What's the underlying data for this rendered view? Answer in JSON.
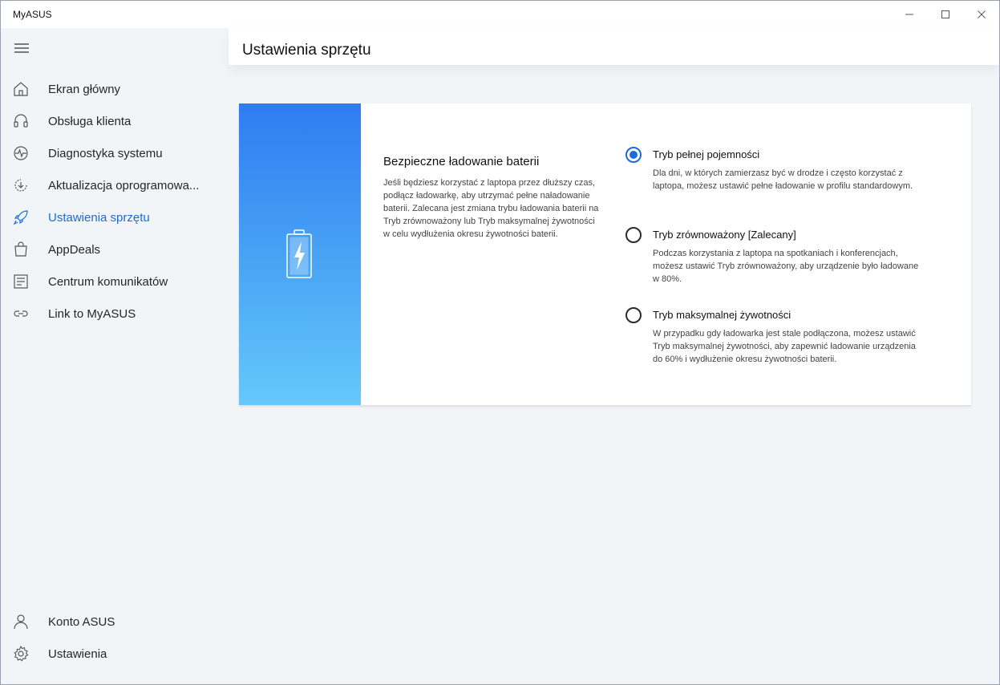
{
  "window": {
    "title": "MyASUS"
  },
  "sidebar": {
    "items": [
      {
        "label": "Ekran główny",
        "icon": "home-icon"
      },
      {
        "label": "Obsługa klienta",
        "icon": "headset-icon"
      },
      {
        "label": "Diagnostyka systemu",
        "icon": "pulse-icon"
      },
      {
        "label": "Aktualizacja oprogramowa...",
        "icon": "update-icon"
      },
      {
        "label": "Ustawienia sprzętu",
        "icon": "rocket-icon",
        "active": true
      },
      {
        "label": "AppDeals",
        "icon": "bag-icon"
      },
      {
        "label": "Centrum komunikatów",
        "icon": "news-icon"
      },
      {
        "label": "Link to MyASUS",
        "icon": "link-icon"
      }
    ],
    "bottom_items": [
      {
        "label": "Konto ASUS",
        "icon": "user-icon"
      },
      {
        "label": "Ustawienia",
        "icon": "gear-icon"
      }
    ]
  },
  "main": {
    "page_title": "Ustawienia sprzętu",
    "card": {
      "title": "Bezpieczne ładowanie baterii",
      "description": "Jeśli będziesz korzystać z laptopa przez dłuższy czas, podłącz ładowarkę, aby utrzymać pełne naładowanie baterii. Zalecana jest zmiana trybu ładowania baterii na Tryb zrównoważony lub Tryb maksymalnej żywotności w celu wydłużenia okresu żywotności baterii.",
      "options": [
        {
          "label": "Tryb pełnej pojemności",
          "description": "Dla dni, w których zamierzasz być w drodze i często korzystać z laptopa, możesz ustawić pełne ładowanie w profilu standardowym.",
          "selected": true
        },
        {
          "label": "Tryb zrównoważony [Zalecany]",
          "description": "Podczas korzystania z laptopa na spotkaniach i konferencjach, możesz ustawić Tryb zrównoważony, aby urządzenie było ładowane w 80%.",
          "selected": false
        },
        {
          "label": "Tryb maksymalnej żywotności",
          "description": "W przypadku gdy ładowarka jest stale podłączona, możesz ustawić Tryb maksymalnej żywotności, aby zapewnić ładowanie urządzenia do 60% i wydłużenie okresu żywotności baterii.",
          "selected": false
        }
      ]
    }
  },
  "colors": {
    "accent": "#1b6bd8",
    "background": "#f2f5f8",
    "banner_top": "#2f7cf2",
    "banner_bottom": "#66c8fb"
  }
}
